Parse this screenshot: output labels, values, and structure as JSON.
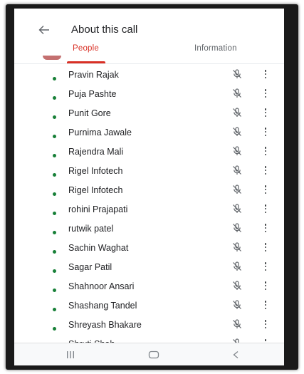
{
  "header": {
    "title": "About this call",
    "back_icon": "arrow-back-icon"
  },
  "tabs": [
    {
      "label": "People",
      "active": true
    },
    {
      "label": "Information",
      "active": false
    }
  ],
  "colors": {
    "accent": "#d93025",
    "presence": "#188038"
  },
  "participants": [
    {
      "name": "Pravin Rajak"
    },
    {
      "name": "Puja Pashte"
    },
    {
      "name": "Punit Gore"
    },
    {
      "name": "Purnima Jawale"
    },
    {
      "name": "Rajendra Mali"
    },
    {
      "name": "Rigel Infotech"
    },
    {
      "name": "Rigel Infotech"
    },
    {
      "name": "rohini Prajapati"
    },
    {
      "name": "rutwik patel"
    },
    {
      "name": "Sachin Waghat"
    },
    {
      "name": "Sagar Patil"
    },
    {
      "name": "Shahnoor Ansari"
    },
    {
      "name": "Shashang Tandel"
    },
    {
      "name": "Shreyash Bhakare"
    },
    {
      "name": "Shruti Shah"
    }
  ],
  "navbar": {
    "icons": [
      "recents-icon",
      "home-icon",
      "back-icon"
    ]
  }
}
